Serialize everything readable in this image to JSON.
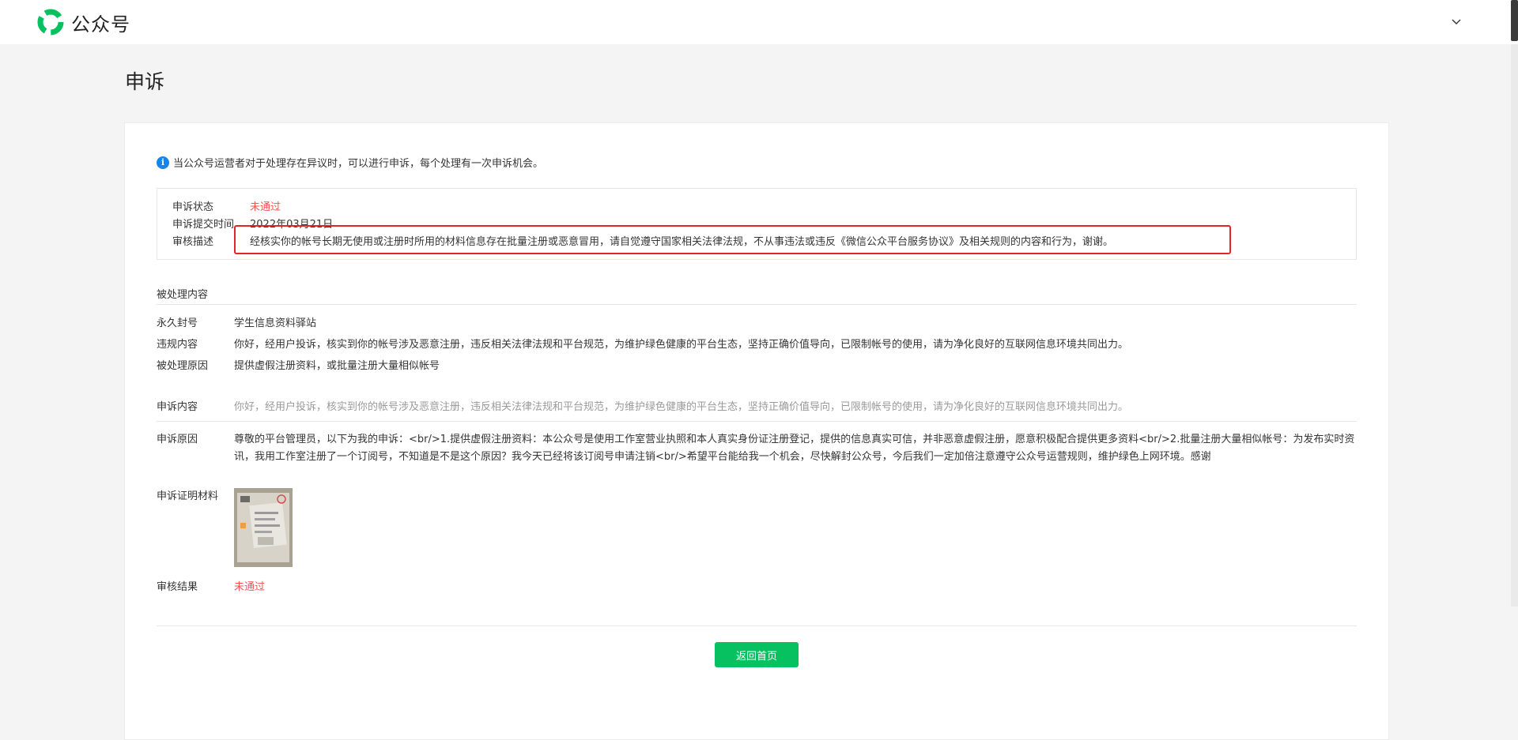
{
  "header": {
    "app_name": "公众号",
    "logo_icon": "wechat-official-account-logo",
    "user_menu_icon": "chevron-down-icon"
  },
  "page": {
    "title": "申诉"
  },
  "tip": {
    "icon": "info-icon",
    "text": "当公众号运营者对于处理存在异议时，可以进行申诉，每个处理有一次申诉机会。"
  },
  "status": {
    "state_label": "申诉状态",
    "state_value": "未通过",
    "submit_label": "申诉提交时间",
    "submit_value": "2022年03月21日",
    "review_label": "审核描述",
    "review_value": "经核实你的帐号长期无使用或注册时所用的材料信息存在批量注册或恶意冒用，请自觉遵守国家相关法律法规，不从事违法或违反《微信公众平台服务协议》及相关规则的内容和行为，谢谢。"
  },
  "punishment": {
    "section_title": "被处理内容",
    "ban_label": "永久封号",
    "ban_value": "学生信息资料驿站",
    "violation_label": "违规内容",
    "violation_value": "你好，经用户投诉，核实到你的帐号涉及恶意注册，违反相关法律法规和平台规范，为维护绿色健康的平台生态，坚持正确价值导向，已限制帐号的使用，请为净化良好的互联网信息环境共同出力。",
    "reason_label": "被处理原因",
    "reason_value": "提供虚假注册资料，或批量注册大量相似帐号"
  },
  "appeal": {
    "content_label": "申诉内容",
    "content_value": "你好，经用户投诉，核实到你的帐号涉及恶意注册，违反相关法律法规和平台规范，为维护绿色健康的平台生态，坚持正确价值导向，已限制帐号的使用，请为净化良好的互联网信息环境共同出力。",
    "reason_label": "申诉原因",
    "reason_value": "尊敬的平台管理员，以下为我的申诉：<br/>1.提供虚假注册资料：本公众号是使用工作室营业执照和本人真实身份证注册登记，提供的信息真实可信，并非恶意虚假注册，愿意积极配合提供更多资料<br/>2.批量注册大量相似帐号：为发布实时资讯，我用工作室注册了一个订阅号，不知道是不是这个原因？我今天已经将该订阅号申请注销<br/>希望平台能给我一个机会，尽快解封公众号，今后我们一定加倍注意遵守公众号运营规则，维护绿色上网环境。感谢",
    "evidence_label": "申诉证明材料",
    "result_label": "审核结果",
    "result_value": "未通过"
  },
  "actions": {
    "home_button": "返回首页"
  },
  "colors": {
    "brand_green": "#07c160",
    "reject_red": "#fa5151",
    "highlight_red": "#e6232a",
    "info_blue": "#1485ee"
  }
}
